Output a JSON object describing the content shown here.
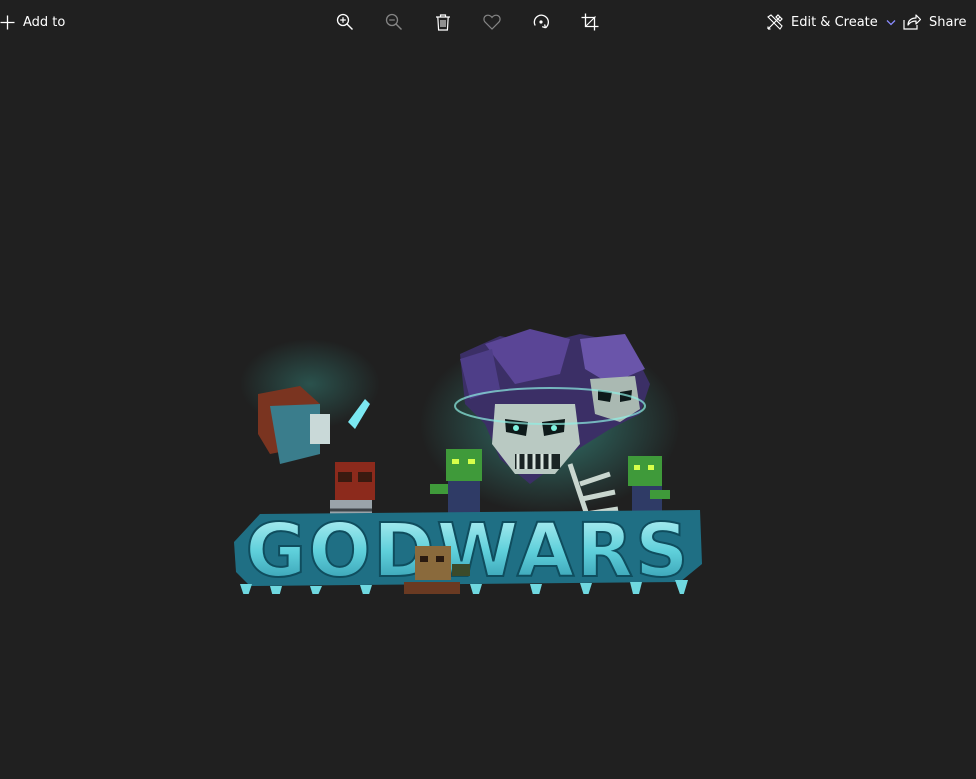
{
  "toolbar": {
    "add_to_label": "Add to",
    "zoom_in": "zoom-in-icon",
    "zoom_out": "zoom-out-icon",
    "delete": "trash-icon",
    "favorite": "heart-icon",
    "rotate": "rotate-icon",
    "crop": "crop-icon",
    "edit_create_label": "Edit & Create",
    "share_label": "Share"
  },
  "image": {
    "logo_text": "GODWARS"
  },
  "colors": {
    "background": "#202020",
    "accent": "#8a8cff",
    "ice": "#6fd8e0",
    "skull_purple": "#4a3b7a"
  }
}
